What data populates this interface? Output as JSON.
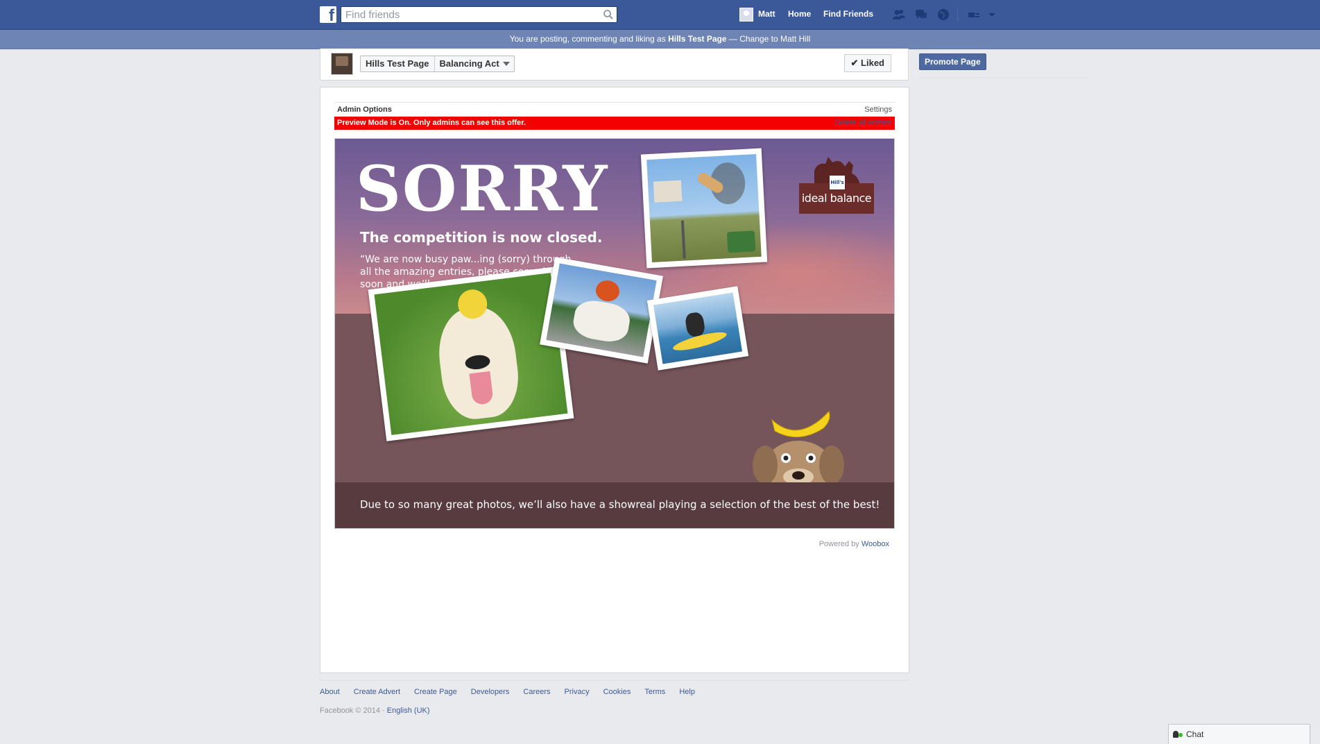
{
  "topbar": {
    "search_placeholder": "Find friends",
    "user_name": "Matt",
    "home_label": "Home",
    "find_friends_label": "Find Friends",
    "icons": [
      "friend-requests-icon",
      "messages-icon",
      "notifications-icon",
      "privacy-shortcuts-icon",
      "account-settings-icon"
    ]
  },
  "posting_banner": {
    "prefix": "You are posting, commenting and liking as ",
    "page_name": "Hills Test Page",
    "separator": " — ",
    "change_link": "Change to Matt Hill"
  },
  "page_header": {
    "page_name": "Hills Test Page",
    "app_name": "Balancing Act",
    "liked_label": "Liked"
  },
  "right_column": {
    "promote_label": "Promote Page"
  },
  "admin": {
    "title": "Admin Options",
    "settings_label": "Settings",
    "preview_message": "Preview Mode is On. Only admins can see this offer.",
    "delete_label": "Delete all entries"
  },
  "banner": {
    "headline": "SORRY",
    "subheadline": "The competition is now closed.",
    "quote": "“We are now busy paw...ing (sorry) through all the amazing entries, please come back soon and we’ll reveal the winning photo”",
    "footnote": "Due to so many great photos, we’ll also have a showreal playing a selection of the best of the best!",
    "brand": "ideal balance",
    "brand_badge": "Hill's"
  },
  "powered_by": {
    "prefix": "Powered by ",
    "link": "Woobox"
  },
  "footer": {
    "links": [
      "About",
      "Create Advert",
      "Create Page",
      "Developers",
      "Careers",
      "Privacy",
      "Cookies",
      "Terms",
      "Help"
    ],
    "copyright": "Facebook © 2014 · ",
    "language": "English (UK)"
  },
  "chat": {
    "label": "Chat"
  },
  "colors": {
    "facebook_blue": "#3b5998",
    "posting_bar": "#6d84b4",
    "preview_red": "#f50000"
  }
}
